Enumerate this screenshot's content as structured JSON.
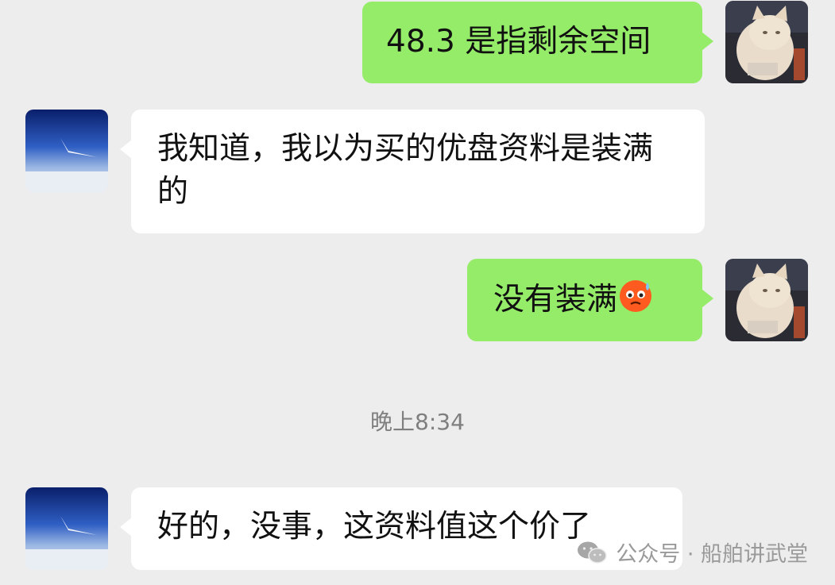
{
  "messages": [
    {
      "text": "48.3 是指剩余空间"
    },
    {
      "text": "我知道，我以为买的优盘资料是装满的"
    },
    {
      "text": "没有装满"
    },
    {
      "text": "好的，没事，这资料值这个价了"
    }
  ],
  "timestamp": "晚上8:34",
  "watermark": {
    "label": "公众号 · 船舶讲武堂"
  },
  "colors": {
    "background": "#ededed",
    "outgoing_bubble": "#95ec69",
    "incoming_bubble": "#ffffff"
  },
  "icons": {
    "self_avatar": "cat-avatar",
    "contact_avatar": "sky-airplane-avatar",
    "emoji": "sweat-face-emoji",
    "watermark_icon": "wechat-icon"
  }
}
